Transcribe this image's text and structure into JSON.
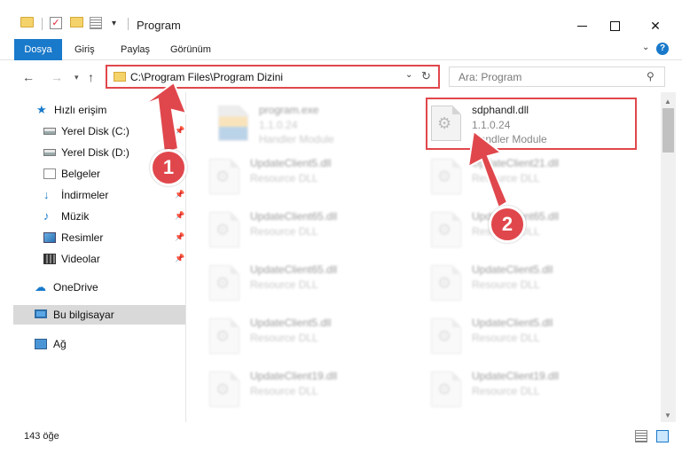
{
  "window": {
    "title": "Program",
    "minimize_glyph": "",
    "close_glyph": "✕"
  },
  "ribbon": {
    "tabs": [
      "Dosya",
      "Giriş",
      "Paylaş",
      "Görünüm"
    ]
  },
  "address": {
    "path": "C:\\Program Files\\Program Dizini"
  },
  "search": {
    "placeholder": "Ara: Program"
  },
  "sidebar": {
    "items": [
      {
        "label": "Hızlı erişim",
        "icon": "star-icon"
      },
      {
        "label": "Yerel Disk (C:)",
        "icon": "disk-icon"
      },
      {
        "label": "Yerel Disk (D:)",
        "icon": "disk-icon"
      },
      {
        "label": "Belgeler",
        "icon": "documents-icon"
      },
      {
        "label": "İndirmeler",
        "icon": "download-icon"
      },
      {
        "label": "Müzik",
        "icon": "music-icon"
      },
      {
        "label": "Resimler",
        "icon": "pictures-icon"
      },
      {
        "label": "Videolar",
        "icon": "video-icon"
      },
      {
        "label": "OneDrive",
        "icon": "cloud-icon"
      },
      {
        "label": "Bu bilgisayar",
        "icon": "computer-icon"
      },
      {
        "label": "Ağ",
        "icon": "network-icon"
      }
    ]
  },
  "files": [
    {
      "name": "program.exe",
      "version": "1.1.0.24",
      "desc": "Handler Module"
    },
    {
      "name": "sdphandl.dll",
      "version": "1.1.0.24",
      "desc": "Handler Module"
    },
    {
      "name": "UpdateClient5.dll",
      "desc": "Resource DLL"
    },
    {
      "name": "UpdateClient21.dll",
      "desc": "Resource DLL"
    },
    {
      "name": "UpdateClient65.dll",
      "desc": "Resource DLL"
    },
    {
      "name": "UpdateClient65.dll",
      "desc": "Resource DLL"
    },
    {
      "name": "UpdateClient65.dll",
      "desc": "Resource DLL"
    },
    {
      "name": "UpdateClient5.dll",
      "desc": "Resource DLL"
    },
    {
      "name": "UpdateClient5.dll",
      "desc": "Resource DLL"
    },
    {
      "name": "UpdateClient5.dll",
      "desc": "Resource DLL"
    },
    {
      "name": "UpdateClient19.dll",
      "desc": "Resource DLL"
    },
    {
      "name": "UpdateClient19.dll",
      "desc": "Resource DLL"
    }
  ],
  "status": {
    "count": "143 öğe"
  },
  "callouts": [
    "1",
    "2"
  ],
  "colors": {
    "accent": "#1979ca",
    "highlight": "#e0474c",
    "selection": "#cce8ff"
  }
}
